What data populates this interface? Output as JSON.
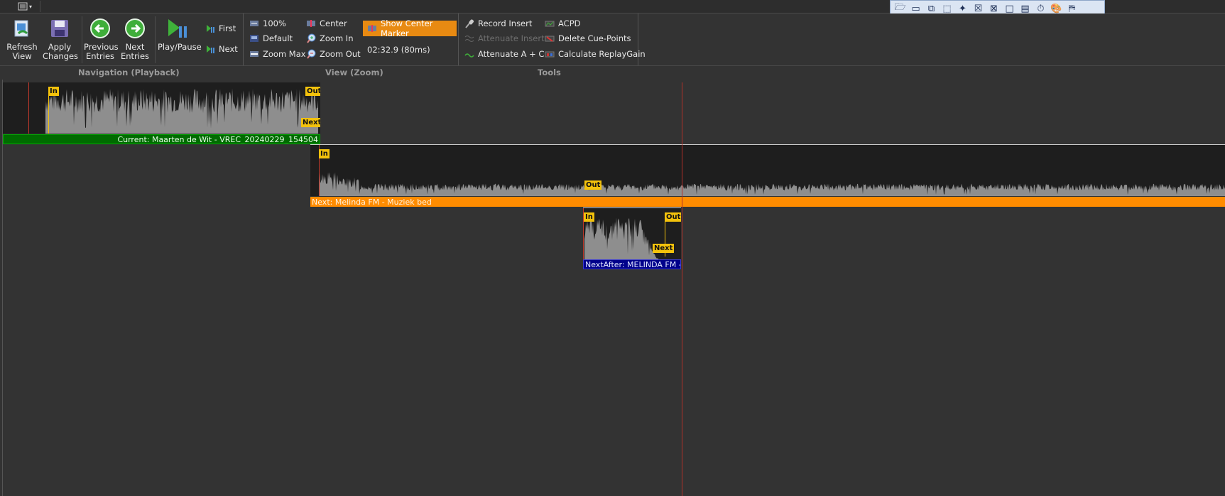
{
  "menu": {
    "icon": "menu-list-icon"
  },
  "ribbon": {
    "refresh": {
      "label": "Refresh View",
      "icon": "refresh-view-icon"
    },
    "apply": {
      "label": "Apply Changes",
      "icon": "floppy-disk-icon"
    },
    "previous": {
      "label": "Previous Entries",
      "icon": "green-left-arrow-icon"
    },
    "next": {
      "label": "Next Entries",
      "icon": "green-right-arrow-icon"
    },
    "playpause": {
      "label": "Play/Pause",
      "icon": "play-pause-icon"
    },
    "first": {
      "label": "First"
    },
    "next_small": {
      "label": "Next"
    },
    "zoom_100": {
      "label": "100%"
    },
    "zoom_default": {
      "label": "Default"
    },
    "zoom_max": {
      "label": "Zoom Max"
    },
    "center": {
      "label": "Center"
    },
    "zoom_in": {
      "label": "Zoom In"
    },
    "zoom_out": {
      "label": "Zoom Out"
    },
    "show_center_marker": {
      "label": "Show Center Marker"
    },
    "time_readout": "02:32.9 (80ms)",
    "record_insert": {
      "label": "Record Insert"
    },
    "attenuate_insert": {
      "label": "Attenuate Insert"
    },
    "attenuate_ac": {
      "label": "Attenuate A + C"
    },
    "acpd": {
      "label": "ACPD"
    },
    "delete_cue": {
      "label": "Delete Cue-Points"
    },
    "replaygain": {
      "label": "Calculate ReplayGain"
    },
    "groups": {
      "navigation": "Navigation (Playback)",
      "view": "View (Zoom)",
      "tools": "Tools"
    }
  },
  "floating_toolbar": {
    "icons": [
      "open-folder-icon",
      "window-icon",
      "window-restore-icon",
      "selection-icon",
      "pin-icon",
      "close-box-icon",
      "fit-icon",
      "frame-icon",
      "film-icon",
      "stopwatch-icon",
      "palette-icon",
      "marker-icon"
    ]
  },
  "tracks": {
    "current": {
      "label": "Current: Maarten de Wit - VREC_20240229_154504",
      "color": "#006b00",
      "in": "In",
      "out": "Out",
      "next": "Next"
    },
    "next": {
      "label": "Next: Melinda FM - Muziek bed",
      "color": "#ff8c00",
      "in": "In",
      "out": "Out"
    },
    "nextafter": {
      "label": "NextAfter: MELINDA FM - ...",
      "color": "#00008b",
      "in": "In",
      "out": "Out",
      "next": "Next"
    }
  },
  "colors": {
    "background": "#333333",
    "accent": "#e88a12",
    "marker": "#f3c20c",
    "playhead": "#c0392b"
  }
}
